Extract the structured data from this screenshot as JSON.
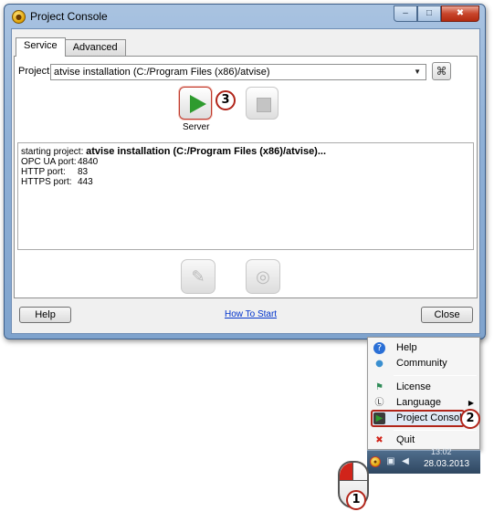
{
  "window": {
    "title": "Project Console",
    "app_icon_glyph": "●",
    "minimize_glyph": "–",
    "maximize_glyph": "□",
    "close_glyph": "✖"
  },
  "tabs": [
    {
      "label": "Service",
      "active": true
    },
    {
      "label": "Advanced",
      "active": false
    }
  ],
  "project": {
    "label": "Project:",
    "value": "atvise installation (C:/Program Files (x86)/atvise)",
    "dropdown_glyph": "▼",
    "refresh_icon": "network-settings-icon",
    "refresh_glyph": "⌘"
  },
  "server": {
    "start_icon": "play-icon",
    "stop_icon": "stop-icon",
    "label": "Server"
  },
  "log": {
    "first_line_prefix": "starting project:",
    "first_line_value": "atvise installation (C:/Program Files (x86)/atvise)...",
    "lines": [
      {
        "key": "OPC UA port:",
        "value": "4840"
      },
      {
        "key": "HTTP port:",
        "value": "83"
      },
      {
        "key": "HTTPS port:",
        "value": "443"
      }
    ]
  },
  "tools": {
    "edit_glyph": "✎",
    "web_glyph": "◎"
  },
  "footer": {
    "help_label": "Help",
    "how_to_start_label": "How To Start",
    "close_label": "Close"
  },
  "callouts": {
    "one": "1",
    "two": "2",
    "three": "3"
  },
  "tray_menu": {
    "items": [
      {
        "label": "Help",
        "icon": "help-icon",
        "glyph": "?",
        "color": "#2a6fd6"
      },
      {
        "label": "Community",
        "icon": "globe-icon",
        "glyph": "●",
        "color": "#3a8fd0"
      },
      {
        "label": "License",
        "icon": "license-icon",
        "glyph": "⚑",
        "color": "#2e8b57"
      },
      {
        "label": "Language",
        "icon": "language-icon",
        "glyph": "Ⓛ",
        "color": "#333333"
      },
      {
        "label": "Project Console",
        "icon": "project-console-icon",
        "glyph": "▶",
        "color": "#2e9b2e"
      },
      {
        "label": "Quit",
        "icon": "quit-icon",
        "glyph": "✖",
        "color": "#d1241a"
      }
    ],
    "submenu_glyph": "▶"
  },
  "taskbar": {
    "app_glyph": "●",
    "network_glyph": "▣",
    "volume_glyph": "◀",
    "time": "13:02",
    "date": "28.03.2013"
  },
  "colors": {
    "callout_border": "#b1251a",
    "play_green": "#2e9b2e",
    "link_blue": "#0033cc"
  }
}
